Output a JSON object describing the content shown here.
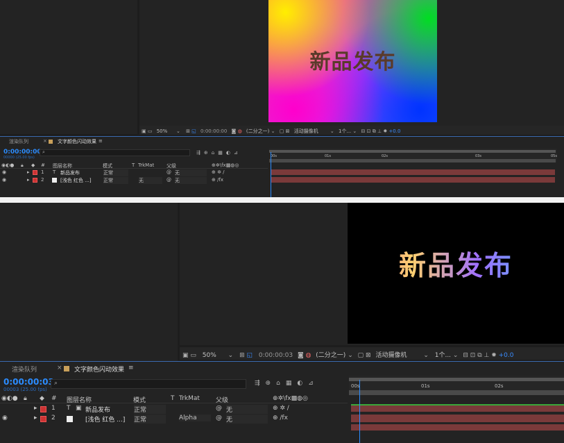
{
  "top": {
    "preview_text": "新品发布",
    "viewer_toolbar": {
      "zoom": "50%",
      "timecode": "0:00:00:00",
      "resolution": "(二分之一)",
      "camera": "活动摄像机",
      "views": "1个...",
      "exposure": "+0.0"
    },
    "tabs": {
      "render_queue": "渲染队列",
      "comp": "文字颜色闪动效果"
    },
    "timecode": "0:00:00:00",
    "timecode_sub": "00000 (25.00 fps)",
    "headers": {
      "num": "#",
      "layer_name": "图层名称",
      "mode": "模式",
      "t": "T",
      "trkmat": "TrkMat",
      "parent": "父级"
    },
    "layers": [
      {
        "num": "1",
        "type": "T",
        "name": "新品发布",
        "mode": "正常",
        "trkmat": "",
        "parent": "无"
      },
      {
        "num": "2",
        "type": "",
        "name": "[浅色 红色 ...]",
        "mode": "正常",
        "trkmat": "无",
        "parent": "无"
      }
    ],
    "ruler": [
      "00s",
      "01s",
      "02s",
      "03s",
      "05s"
    ]
  },
  "bottom": {
    "preview_text": "新品发布",
    "viewer_toolbar": {
      "zoom": "50%",
      "timecode": "0:00:00:03",
      "resolution": "(二分之一)",
      "camera": "活动摄像机",
      "views": "1个...",
      "exposure": "+0.0"
    },
    "tabs": {
      "render_queue": "渲染队列",
      "comp": "文字颜色闪动效果"
    },
    "timecode": "0:00:00:03",
    "timecode_sub": "00003 (25.00 fps)",
    "headers": {
      "num": "#",
      "layer_name": "图层名称",
      "mode": "模式",
      "t": "T",
      "trkmat": "TrkMat",
      "parent": "父级"
    },
    "layers": [
      {
        "num": "1",
        "type": "T",
        "name": "新品发布",
        "mode": "正常",
        "trkmat": "",
        "parent": "无"
      },
      {
        "num": "2",
        "type": "",
        "name": "[浅色 红色 ...]",
        "mode": "正常",
        "trkmat": "Alpha",
        "parent": "无"
      }
    ],
    "ruler": [
      "00s",
      "01s",
      "02s"
    ]
  },
  "colors": {
    "bg": "#1d1d1d",
    "timecode": "#2b8cff",
    "layer_bar": "#7a3a3a",
    "label_red": "#cc3333",
    "playhead": "#2b8cff"
  }
}
